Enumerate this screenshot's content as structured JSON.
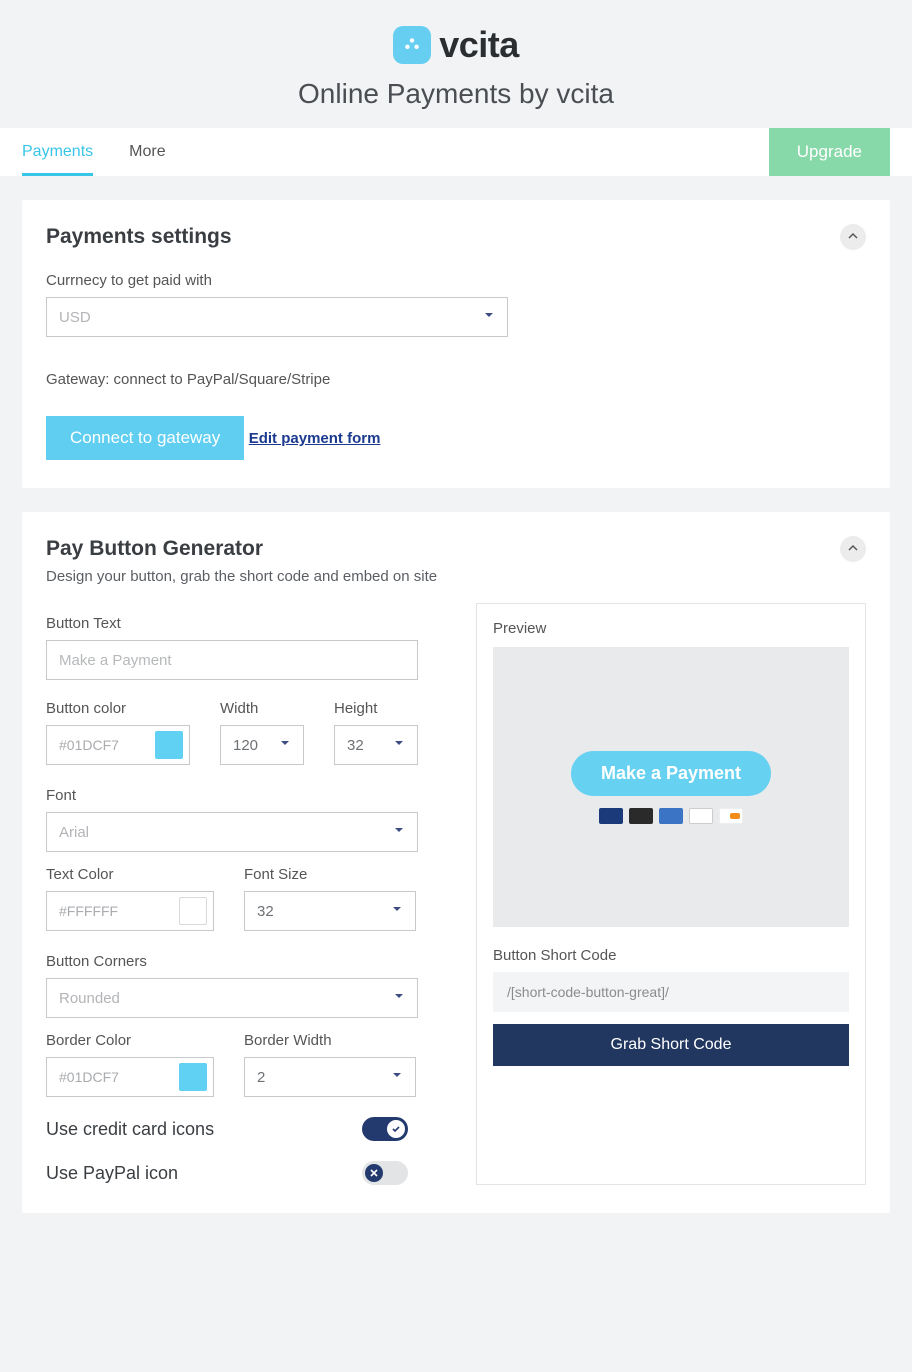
{
  "header": {
    "brand": "vcita",
    "subtitle": "Online Payments by vcita"
  },
  "tabs": {
    "payments": "Payments",
    "more": "More",
    "upgrade": "Upgrade"
  },
  "settings": {
    "title": "Payments settings",
    "currency_label": "Currnecy to get paid with",
    "currency_value": "USD",
    "gateway_label": "Gateway: connect to PayPal/Square/Stripe",
    "connect_button": "Connect to gateway",
    "edit_link": "Edit payment form"
  },
  "generator": {
    "title": "Pay Button Generator",
    "subtitle": "Design your button, grab the short code and embed on site",
    "button_text_label": "Button Text",
    "button_text_placeholder": "Make a Payment",
    "button_color_label": "Button color",
    "button_color_value": "#01DCF7",
    "width_label": "Width",
    "width_value": "120",
    "height_label": "Height",
    "height_value": "32",
    "font_label": "Font",
    "font_value": "Arial",
    "text_color_label": "Text Color",
    "text_color_value": "#FFFFFF",
    "font_size_label": "Font Size",
    "font_size_value": "32",
    "corners_label": "Button Corners",
    "corners_value": "Rounded",
    "border_color_label": "Border Color",
    "border_color_value": "#01DCF7",
    "border_width_label": "Border Width",
    "border_width_value": "2",
    "toggle_cc_label": "Use credit card icons",
    "toggle_cc_on": true,
    "toggle_paypal_label": "Use PayPal icon",
    "toggle_paypal_on": false
  },
  "preview": {
    "label": "Preview",
    "button_text": "Make a Payment",
    "shortcode_label": "Button Short Code",
    "shortcode_value": "/[short-code-button-great]/",
    "grab_button": "Grab Short Code"
  }
}
